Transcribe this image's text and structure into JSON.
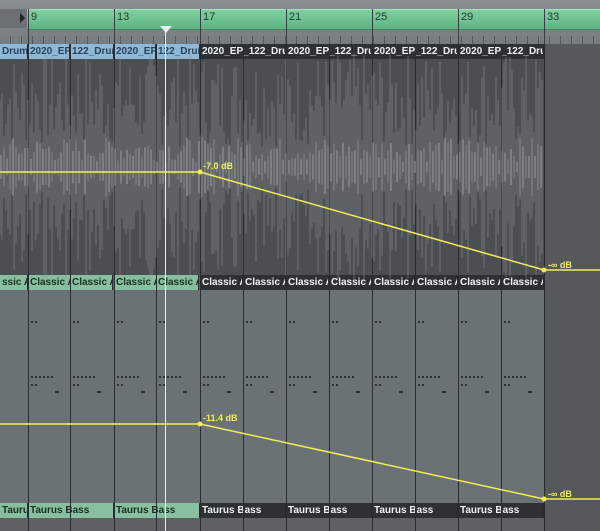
{
  "ruler": {
    "bar_numbers": [
      "9",
      "13",
      "17",
      "21",
      "25",
      "29",
      "33"
    ]
  },
  "tracks": {
    "drums": {
      "region_name_partial": "Drum",
      "regions": [
        "2020_EP",
        "122_Drum",
        "2020_EP",
        "122_Drum",
        "2020_EP_122_Drum",
        "2020_EP_122_Drum",
        "2020_EP_122_Drum",
        "2020_EP_122_Drum",
        "2020_EP_122_Drum"
      ],
      "volume_start": "-7.0 dB",
      "volume_end": "-∞ dB"
    },
    "keys": {
      "region_name_partial": "ssic A",
      "regions": [
        "Classic A",
        "Classic A",
        "Classic A",
        "Classic A",
        "Classic A",
        "Classic A",
        "Classic A",
        "Classic A",
        "Classic A",
        "Classic A",
        "Classic A",
        "Classic A"
      ],
      "volume_start": "-11.4 dB",
      "volume_end": "-∞ dB"
    },
    "bass": {
      "regions": [
        "Taurus Bass",
        "Taurus Bass",
        "Taurus Bass",
        "Taurus Bass",
        "Taurus Bass",
        "Taurus Bass",
        "Taurus Bass"
      ]
    }
  },
  "colors": {
    "cycle_green": "#6cc391",
    "automation_yellow": "#f2ee58",
    "region_dark": "#2e3134",
    "region_blue": "#8fb8d6",
    "region_green": "#88bfa0"
  }
}
